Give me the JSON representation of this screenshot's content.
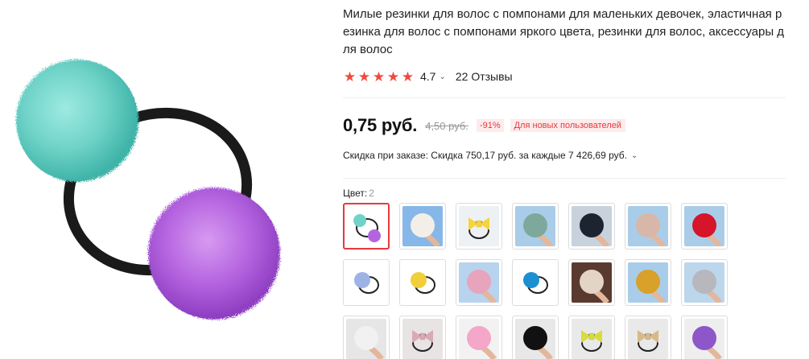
{
  "product": {
    "title": "Милые резинки для волос с помпонами для маленьких девочек, эластичная резинка для волос с помпонами яркого цвета, резинки для волос, аксессуары для волос",
    "rating": "4.7",
    "reviews": "22 Отзывы",
    "rating_stars": 5
  },
  "price": {
    "current": "0,75 руб.",
    "old": "4,50 руб.",
    "discount": "-91%",
    "badge": "Для новых пользователей"
  },
  "order_discount": {
    "text": "Скидка при заказе: Скидка 750,17 руб. за каждые 7 426,69 руб."
  },
  "color": {
    "label": "Цвет:",
    "count": "2",
    "selected_index": 0,
    "swatches": [
      {
        "kind": "pair",
        "bg": "#ffffff",
        "c1": "#6fd3c8",
        "c2": "#b564e0"
      },
      {
        "kind": "ball",
        "bg": "#86b7e8",
        "c1": "#f3efe8"
      },
      {
        "kind": "bow",
        "bg": "#eef1f4",
        "c1": "#f5d53a"
      },
      {
        "kind": "ball",
        "bg": "#a9cde9",
        "c1": "#7fa89c"
      },
      {
        "kind": "ball",
        "bg": "#c8d2dc",
        "c1": "#1d2431"
      },
      {
        "kind": "ball",
        "bg": "#a9cde9",
        "c1": "#d8b6a8"
      },
      {
        "kind": "ball",
        "bg": "#a9cde9",
        "c1": "#d6142a"
      },
      {
        "kind": "ring",
        "bg": "#ffffff",
        "c1": "#9db3e6"
      },
      {
        "kind": "ring",
        "bg": "#ffffff",
        "c1": "#f0cf3a"
      },
      {
        "kind": "ball",
        "bg": "#b8d3ee",
        "c1": "#e8a4bc"
      },
      {
        "kind": "ring",
        "bg": "#ffffff",
        "c1": "#1b8fd1"
      },
      {
        "kind": "ball",
        "bg": "#5a3a2e",
        "c1": "#e4d4c6"
      },
      {
        "kind": "ball",
        "bg": "#a9cde9",
        "c1": "#d9a12a"
      },
      {
        "kind": "ball",
        "bg": "#bcd6ec",
        "c1": "#b7b7bd"
      },
      {
        "kind": "ball",
        "bg": "#e6e6e6",
        "c1": "#f1f1f1"
      },
      {
        "kind": "bow",
        "bg": "#e8e4e4",
        "c1": "#d9a9b4"
      },
      {
        "kind": "ball",
        "bg": "#f2f2f2",
        "c1": "#f4a7c8"
      },
      {
        "kind": "ball",
        "bg": "#e8e8e8",
        "c1": "#111111"
      },
      {
        "kind": "bow",
        "bg": "#e9e9e9",
        "c1": "#d8dc3a"
      },
      {
        "kind": "bow",
        "bg": "#e9e9e9",
        "c1": "#d9b98a"
      },
      {
        "kind": "ball",
        "bg": "#eeeeee",
        "c1": "#8e57c9"
      }
    ]
  },
  "colors": {
    "accent": "#e8383d",
    "star": "#f04a3f",
    "main_pompom_1": "#6fd3c8",
    "main_pompom_2": "#b564e0"
  }
}
